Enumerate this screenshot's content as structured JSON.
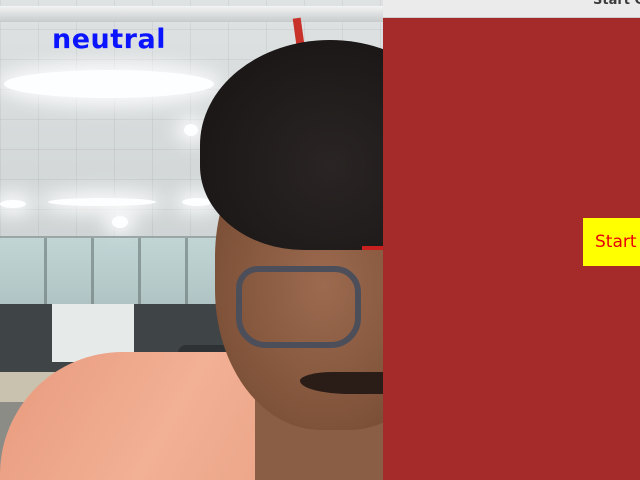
{
  "camera": {
    "emotion_label": "neutral",
    "label_color": "#0a14ff"
  },
  "app_window": {
    "title": "Start C",
    "background_color": "#a52a2a",
    "start_button": {
      "label": "Start",
      "background_color": "#ffff00",
      "text_color": "#e8000b"
    }
  }
}
